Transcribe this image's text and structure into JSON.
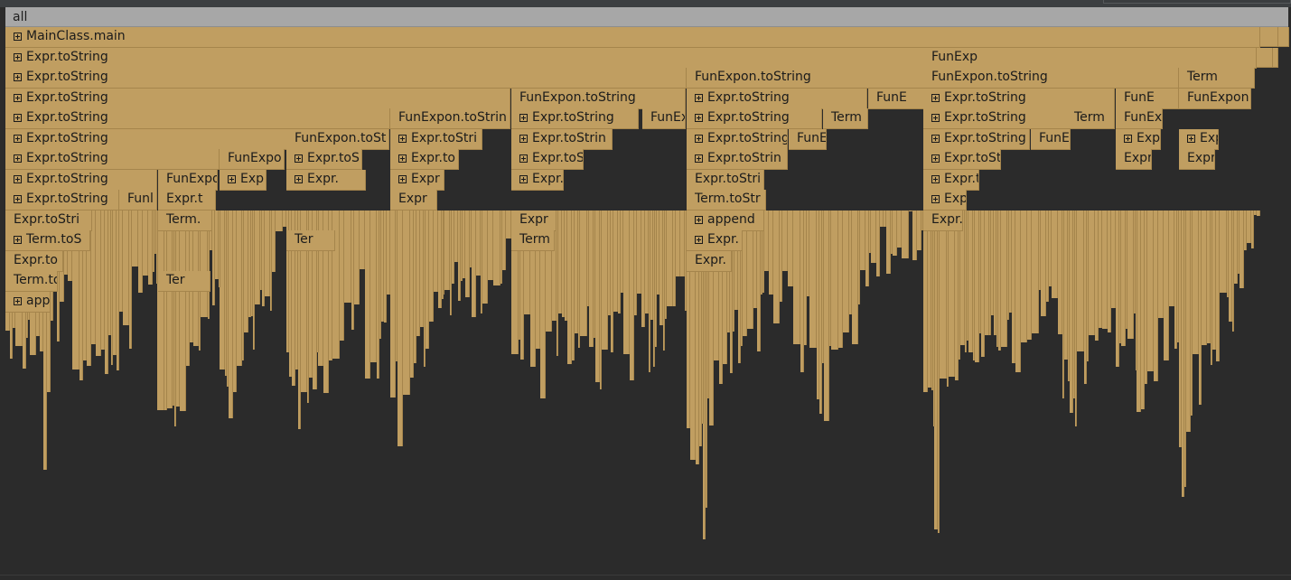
{
  "root": {
    "label": "all"
  },
  "colors": {
    "frame": "#c09e61",
    "frame_border": "#a5854c",
    "root": "#a7a7a7",
    "background": "#2b2b2b"
  },
  "frames": [
    {
      "label": "MainClass.main",
      "expandable": true
    },
    {
      "label": "Expr.toString",
      "expandable": true
    },
    {
      "label": "Expr.toString",
      "expandable": true
    },
    {
      "label": "Expr.toString",
      "expandable": true
    },
    {
      "label": "Expr.toString",
      "expandable": true
    },
    {
      "label": "Expr.toString",
      "expandable": true
    },
    {
      "label": "Expr.toString",
      "expandable": true
    },
    {
      "label": "Expr.toString",
      "expandable": true
    },
    {
      "label": "Expr.toString",
      "expandable": true
    },
    {
      "label": "Expr.toStri",
      "expandable": false
    },
    {
      "label": "Term.toS",
      "expandable": true
    },
    {
      "label": "Expr.to",
      "expandable": false
    },
    {
      "label": "Term.to",
      "expandable": false
    },
    {
      "label": "appe",
      "expandable": true
    },
    {
      "label": "Funl",
      "expandable": false
    },
    {
      "label": "FunExpo",
      "expandable": false
    },
    {
      "label": "Expr.t",
      "expandable": false
    },
    {
      "label": "Term.",
      "expandable": false
    },
    {
      "label": "Ter",
      "expandable": false
    },
    {
      "label": "FunExpo",
      "expandable": false
    },
    {
      "label": "Exp",
      "expandable": true
    },
    {
      "label": "FunExpon.toSt",
      "expandable": false
    },
    {
      "label": "Expr.toS",
      "expandable": true
    },
    {
      "label": "Expr.",
      "expandable": true
    },
    {
      "label": "Ter",
      "expandable": false
    },
    {
      "label": "FunExpon.toStrin",
      "expandable": false
    },
    {
      "label": "Expr.toStri",
      "expandable": true
    },
    {
      "label": "Expr.to",
      "expandable": true
    },
    {
      "label": "Expr",
      "expandable": true
    },
    {
      "label": "Expr",
      "expandable": false
    },
    {
      "label": "FunExpon.toString",
      "expandable": false
    },
    {
      "label": "Expr.toString",
      "expandable": true
    },
    {
      "label": "Expr.toStrin",
      "expandable": true
    },
    {
      "label": "Expr.toS",
      "expandable": true
    },
    {
      "label": "Expr.",
      "expandable": true
    },
    {
      "label": "Expr",
      "expandable": false
    },
    {
      "label": "Term",
      "expandable": false
    },
    {
      "label": "FunEx",
      "expandable": false
    },
    {
      "label": "FunExpon.toString",
      "expandable": false
    },
    {
      "label": "Expr.toString",
      "expandable": true
    },
    {
      "label": "Expr.toString",
      "expandable": true
    },
    {
      "label": "Expr.toString",
      "expandable": true
    },
    {
      "label": "Expr.toStrin",
      "expandable": true
    },
    {
      "label": "Expr.toStri",
      "expandable": false
    },
    {
      "label": "Term.toStr",
      "expandable": false
    },
    {
      "label": "append",
      "expandable": true
    },
    {
      "label": "Expr.",
      "expandable": true
    },
    {
      "label": "Expr.",
      "expandable": false
    },
    {
      "label": "Term",
      "expandable": false
    },
    {
      "label": "FunEx",
      "expandable": false
    },
    {
      "label": "FunE",
      "expandable": false
    },
    {
      "label": "FunExp",
      "expandable": false
    },
    {
      "label": "FunExpon.toString",
      "expandable": false
    },
    {
      "label": "Expr.toString",
      "expandable": true
    },
    {
      "label": "Expr.toString",
      "expandable": true
    },
    {
      "label": "Expr.toString",
      "expandable": true
    },
    {
      "label": "Expr.toString",
      "expandable": true
    },
    {
      "label": "Expr.toS",
      "expandable": true
    },
    {
      "label": "Expr.",
      "expandable": true
    },
    {
      "label": "Expr.",
      "expandable": false
    },
    {
      "label": "Term",
      "expandable": false
    },
    {
      "label": "FunExp",
      "expandable": false
    },
    {
      "label": "FunE",
      "expandable": false
    },
    {
      "label": "FunExpo",
      "expandable": false
    },
    {
      "label": "Expr",
      "expandable": true
    },
    {
      "label": "Expr",
      "expandable": false
    },
    {
      "label": "Term",
      "expandable": false
    },
    {
      "label": "FunExpon.t",
      "expandable": false
    },
    {
      "label": "Expr.t",
      "expandable": true
    },
    {
      "label": "Expr",
      "expandable": false
    },
    {
      "label": "Term",
      "expandable": false
    }
  ]
}
